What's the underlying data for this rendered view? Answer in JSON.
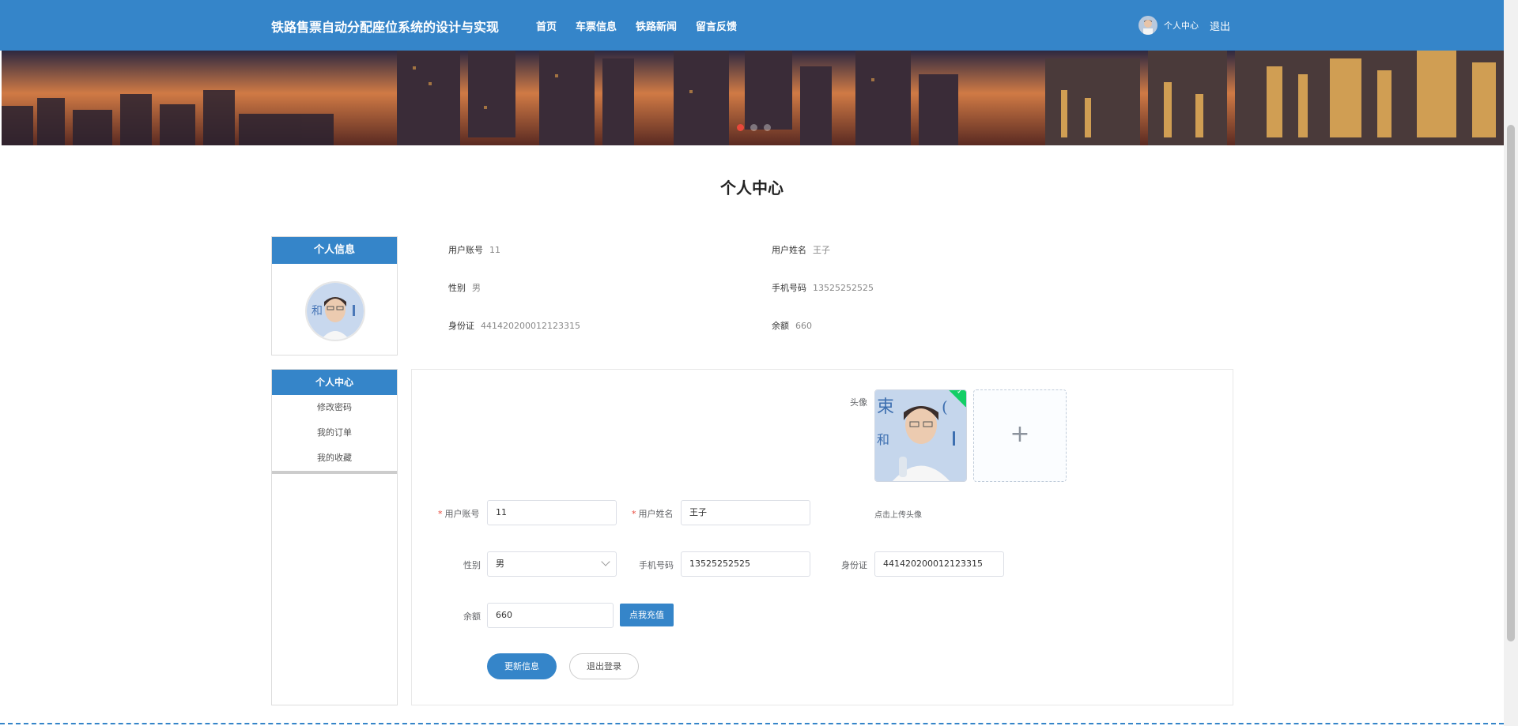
{
  "header": {
    "brand": "铁路售票自动分配座位系统的设计与实现",
    "nav": [
      "首页",
      "车票信息",
      "铁路新闻",
      "留言反馈"
    ],
    "user_center": "个人中心",
    "logout": "退出"
  },
  "banner": {
    "active_slide": 1,
    "slide_count": 3
  },
  "page_title": "个人中心",
  "profile_panel": {
    "title": "个人信息"
  },
  "profile_info": {
    "account_label": "用户账号",
    "account_value": "11",
    "name_label": "用户姓名",
    "name_value": "王子",
    "gender_label": "性别",
    "gender_value": "男",
    "phone_label": "手机号码",
    "phone_value": "13525252525",
    "idcard_label": "身份证",
    "idcard_value": "441420200012123315",
    "balance_label": "余额",
    "balance_value": "660"
  },
  "menu": {
    "title": "个人中心",
    "items": [
      "修改密码",
      "我的订单",
      "我的收藏"
    ]
  },
  "form": {
    "avatar_label": "头像",
    "upload_tip": "点击上传头像",
    "account_label": "用户账号",
    "account_value": "11",
    "name_label": "用户姓名",
    "name_value": "王子",
    "gender_label": "性别",
    "gender_value": "男",
    "phone_label": "手机号码",
    "phone_value": "13525252525",
    "idcard_label": "身份证",
    "idcard_value": "441420200012123315",
    "balance_label": "余额",
    "balance_value": "660",
    "required_mark": "*",
    "recharge_button": "点我充值",
    "update_button": "更新信息",
    "logout_button": "退出登录",
    "add_icon": "+"
  },
  "colors": {
    "primary": "#3585c9",
    "danger": "#e8483b",
    "success": "#13ce66"
  }
}
